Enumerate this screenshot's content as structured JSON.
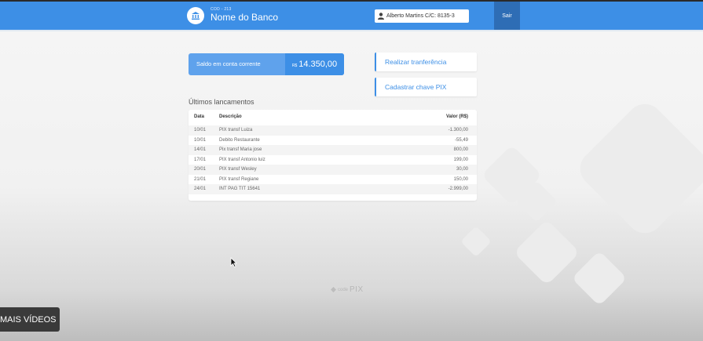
{
  "header": {
    "bank_code": "COD - 213",
    "bank_name": "Nome do Banco",
    "user_label": "Alberto Martins  C/C: 8135-3",
    "exit_label": "Sair",
    "accent_color": "#3d8fe6"
  },
  "balance": {
    "label": "Saldo em conta corrente",
    "currency": "R$",
    "value": "14.350,00"
  },
  "actions": {
    "transfer_label": "Realizar tranferência",
    "pix_key_label": "Cadastrar chave PIX"
  },
  "transactions": {
    "title": "Últimos lancamentos",
    "columns": [
      "Data",
      "Descrição",
      "Valor (R$)"
    ],
    "rows": [
      {
        "date": "10/01",
        "desc": "PIX transf  Luiza",
        "value": "-1.300,00"
      },
      {
        "date": "10/01",
        "desc": "Debito Restaurante",
        "value": "-55,49"
      },
      {
        "date": "14/01",
        "desc": "Pix transf Maria jose",
        "value": "800,00"
      },
      {
        "date": "17/01",
        "desc": "PIX transf  Antonio luiz",
        "value": "199,00"
      },
      {
        "date": "20/01",
        "desc": "PIX transf  Wesley",
        "value": "30,00"
      },
      {
        "date": "21/01",
        "desc": "PIX transf  Regiane",
        "value": "150,00"
      },
      {
        "date": "24/01",
        "desc": "INT PAG TIT 15641",
        "value": "-2.999,00"
      }
    ]
  },
  "watermark": {
    "code": "code",
    "pix": "PIX"
  },
  "overlay": {
    "more_videos_label": "MAIS VÍDEOS"
  }
}
